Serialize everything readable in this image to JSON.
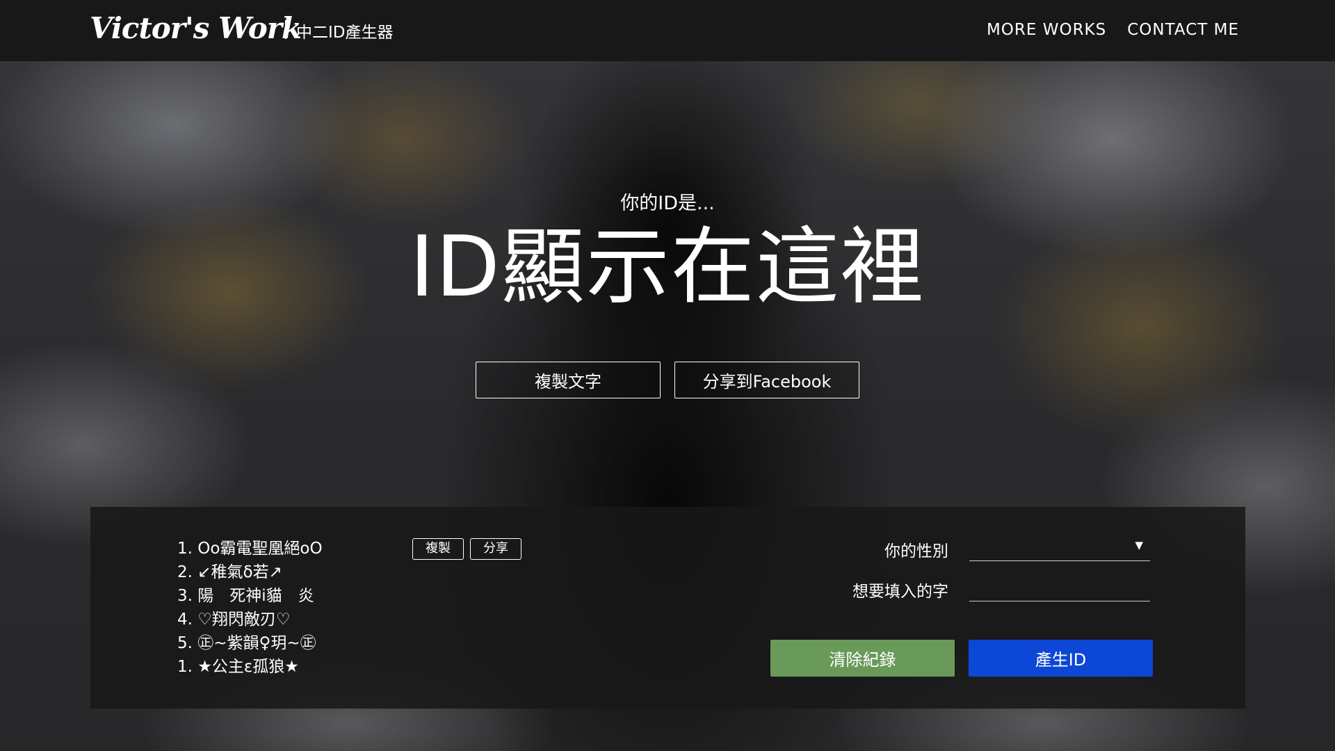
{
  "header": {
    "logo": "Victor's Work",
    "subtitle": "中二ID產生器",
    "nav": [
      "MORE WORKS",
      "CONTACT ME"
    ]
  },
  "hero": {
    "prefix": "你的ID是...",
    "id_text": "ID顯示在這裡",
    "copy_label": "複製文字",
    "share_label": "分享到Facebook"
  },
  "history": {
    "items": [
      "1. Oo霸電聖凰絕oO",
      "2. ↙稚氣δ若↗",
      "3. 陽　死神i貓　炎",
      "4. ♡翔閃敵刃♡",
      "5. ㊣~紫韻♀玥~㊣",
      "1. ★公主ε孤狼★"
    ],
    "copy_label": "複製",
    "share_label": "分享"
  },
  "form": {
    "gender_label": "你的性別",
    "gender_value": "",
    "word_label": "想要填入的字",
    "word_value": ""
  },
  "actions": {
    "clear_label": "清除紀錄",
    "generate_label": "產生ID"
  },
  "colors": {
    "header_bg": "#181818",
    "clear_button": "#6a9a5a",
    "generate_button": "#0c47d6"
  }
}
